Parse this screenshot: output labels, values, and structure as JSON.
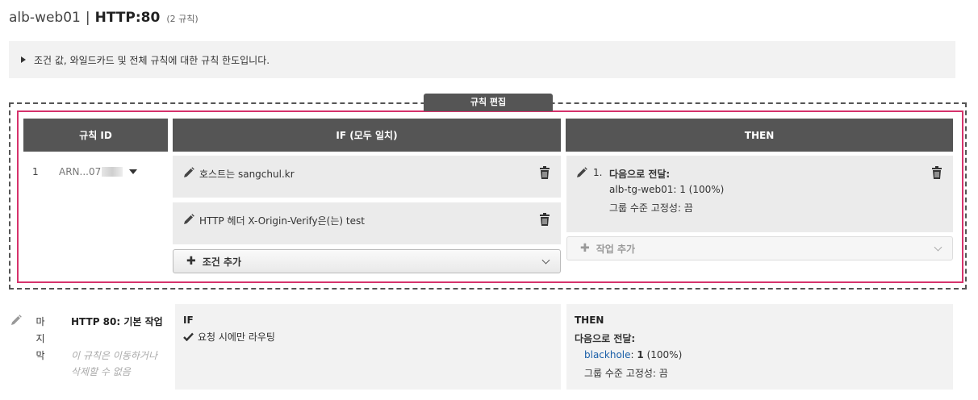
{
  "page_title": {
    "lb_name": "alb-web01",
    "separator": "|",
    "listener": "HTTP:80",
    "rule_count": "(2 규칙)"
  },
  "info": {
    "text": "조건 값, 와일드카드 및 전체 규칙에 대한 규칙 한도입니다."
  },
  "edit_tab": "규칙 편집",
  "headers": {
    "rule_id": "규칙 ID",
    "if": "IF (모두 일치)",
    "then": "THEN"
  },
  "rule": {
    "number": "1",
    "arn": "ARN...07",
    "conditions": [
      {
        "text": "호스트는 sangchul.kr"
      },
      {
        "text": "HTTP 헤더 X-Origin-Verify은(는) test"
      }
    ],
    "add_condition_label": "조건 추가",
    "action": {
      "index": "1.",
      "title": "다음으로 전달:",
      "target": "alb-tg-web01: 1 (100%)",
      "stickiness": "그룹 수준 고정성: 끔"
    },
    "add_action_label": "작업 추가"
  },
  "last_rule": {
    "label_chars": [
      "마",
      "지",
      "막"
    ],
    "title": "HTTP 80: 기본 작업",
    "note": "이 규칙은 이동하거나 삭제할 수 없음",
    "if_header": "IF",
    "if_text": "요청 시에만 라우팅",
    "then_header": "THEN",
    "then_title": "다음으로 전달:",
    "target_name": "blackhole",
    "target_weight_bold": "1",
    "target_pct": "(100%)",
    "target_sep": ":",
    "stickiness": "그룹 수준 고정성: 끔"
  },
  "colors": {
    "header_bg": "#555555",
    "highlight": "#d6336c",
    "link": "#1a5fa8"
  }
}
